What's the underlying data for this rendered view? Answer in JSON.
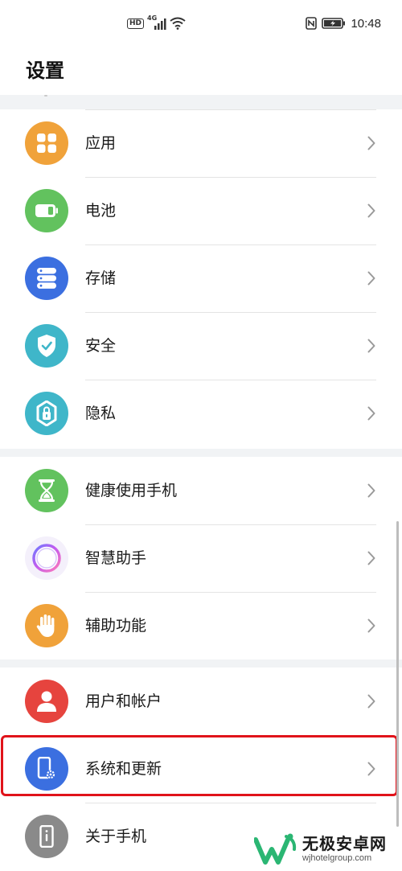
{
  "status_bar": {
    "hd": "HD",
    "network": "4G",
    "time": "10:48"
  },
  "header": {
    "title": "设置"
  },
  "groups": [
    {
      "items": [
        {
          "label": "应用",
          "icon": "apps-icon",
          "color": "#f0a23a"
        },
        {
          "label": "电池",
          "icon": "battery-icon",
          "color": "#62c25e"
        },
        {
          "label": "存储",
          "icon": "storage-icon",
          "color": "#3b6fe0"
        },
        {
          "label": "安全",
          "icon": "shield-check-icon",
          "color": "#3fb6c9"
        },
        {
          "label": "隐私",
          "icon": "privacy-lock-icon",
          "color": "#3fb6c9"
        }
      ]
    },
    {
      "items": [
        {
          "label": "健康使用手机",
          "icon": "hourglass-icon",
          "color": "#62c25e"
        },
        {
          "label": "智慧助手",
          "icon": "assistant-orb-icon",
          "color": "#f4f0fb"
        },
        {
          "label": "辅助功能",
          "icon": "hand-icon",
          "color": "#f0a23a"
        }
      ]
    },
    {
      "items": [
        {
          "label": "用户和帐户",
          "icon": "user-icon",
          "color": "#e6443e"
        },
        {
          "label": "系统和更新",
          "icon": "phone-settings-icon",
          "color": "#3b6fe0",
          "highlighted": true
        },
        {
          "label": "关于手机",
          "icon": "phone-info-icon",
          "color": "#8a8a8a"
        }
      ]
    }
  ],
  "highlight_color": "#e0131a",
  "watermark": {
    "name": "无极安卓网",
    "url": "wjhotelgroup.com"
  }
}
